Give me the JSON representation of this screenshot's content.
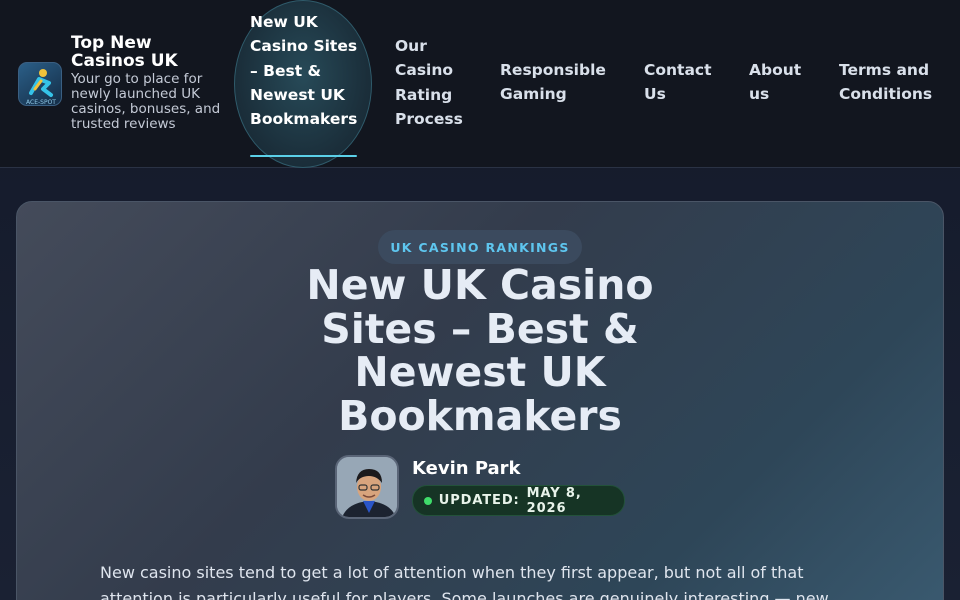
{
  "header": {
    "brand_title": "Top New Casinos UK",
    "brand_tagline": "Your go to place for newly launched UK casinos, bonuses, and trusted reviews",
    "logo_text": "ACE-SPOT",
    "nav": [
      {
        "label": "New UK Casino Sites – Best & Newest UK Bookmakers",
        "active": true
      },
      {
        "label": "Our Casino Rating Process"
      },
      {
        "label": "Responsible Gaming"
      },
      {
        "label": "Contact Us"
      },
      {
        "label": "About us"
      },
      {
        "label": "Terms and Conditions"
      }
    ]
  },
  "hero": {
    "badge": "UK CASINO RANKINGS",
    "title": "New UK Casino Sites – Best & Newest UK Bookmakers",
    "author": "Kevin Park",
    "updated_label": "UPDATED:",
    "updated_date": "MAY 8, 2026",
    "intro": "New casino sites tend to get a lot of attention when they first appear, but not all of that attention is particularly useful for players. Some launches are genuinely interesting — new"
  },
  "colors": {
    "accent": "#5bd0e8",
    "badge_text": "#5ec6ef",
    "status_green": "#3fdc6a",
    "header_bg": "#12161f"
  }
}
